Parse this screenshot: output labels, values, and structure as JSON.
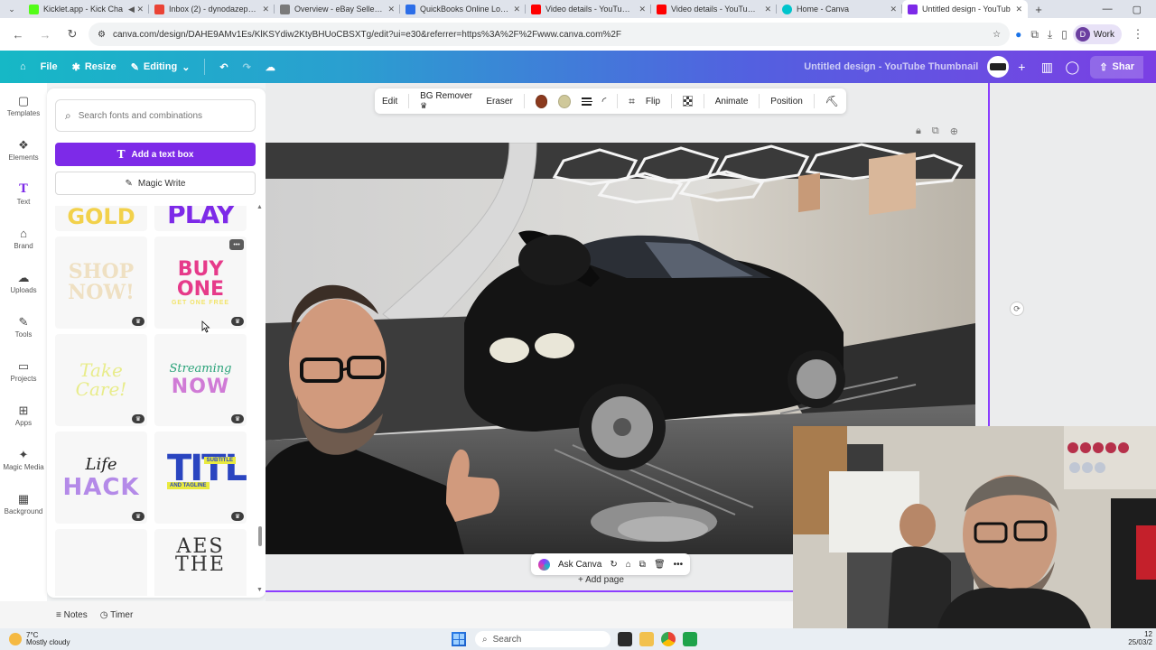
{
  "browser": {
    "tabs": [
      {
        "label": "Kicklet.app - Kick Cha",
        "color": "#53fc18",
        "active": false
      },
      {
        "label": "Inbox (2) - dynodazepp@",
        "color": "#ea4335",
        "active": false
      },
      {
        "label": "Overview - eBay Seller Hu",
        "color": "#7a7a7a",
        "active": false
      },
      {
        "label": "QuickBooks Online Login",
        "color": "#2ca01c",
        "active": false
      },
      {
        "label": "Video details - YouTube S",
        "color": "#ff0000",
        "active": false
      },
      {
        "label": "Video details - YouTube S",
        "color": "#ff0000",
        "active": false
      },
      {
        "label": "Home - Canva",
        "color": "#00c4cc",
        "active": false
      },
      {
        "label": "Untitled design - YouTub",
        "color": "#7d2ae8",
        "active": true
      }
    ],
    "url": "canva.com/design/DAHE9AMv1Es/KlKSYdiw2KtyBHUoCBSXTg/edit?ui=e30&referrer=https%3A%2F%2Fwww.canva.com%2F",
    "profile_initial": "D",
    "profile_label": "Work"
  },
  "header": {
    "file_label": "File",
    "resize_label": "Resize",
    "editing_label": "Editing",
    "design_title": "Untitled design - YouTube Thumbnail",
    "share_label": "Shar"
  },
  "rail": [
    {
      "label": "Templates",
      "icon": "templates-icon",
      "glyph": "▢"
    },
    {
      "label": "Elements",
      "icon": "elements-icon",
      "glyph": "❖"
    },
    {
      "label": "Text",
      "icon": "text-icon",
      "glyph": "T"
    },
    {
      "label": "Brand",
      "icon": "brand-icon",
      "glyph": "⌂"
    },
    {
      "label": "Uploads",
      "icon": "uploads-icon",
      "glyph": "☁"
    },
    {
      "label": "Tools",
      "icon": "tools-icon",
      "glyph": "✎"
    },
    {
      "label": "Projects",
      "icon": "projects-icon",
      "glyph": "▭"
    },
    {
      "label": "Apps",
      "icon": "apps-icon",
      "glyph": "⊞"
    },
    {
      "label": "Magic Media",
      "icon": "magic-media-icon",
      "glyph": "✦"
    },
    {
      "label": "Background",
      "icon": "background-icon",
      "glyph": "▦"
    }
  ],
  "panel": {
    "search_placeholder": "Search fonts and combinations",
    "add_text_label": "Add a text box",
    "magic_write_label": "Magic Write",
    "presets": {
      "gold": "GOLD",
      "play": "PLAY",
      "shop_1": "SHOP",
      "shop_2": "NOW!",
      "buy": "BUY ONE",
      "buy_sub": "GET ONE FREE",
      "take_1": "Take",
      "take_2": "Care!",
      "stream_1": "Streaming",
      "stream_2": "NOW",
      "life_1": "Life",
      "life_2": "HACK",
      "title": "TITLE",
      "title_sub": "SUBTITLE",
      "title_tag": "AND TAGLINE",
      "aes": "AES THE"
    }
  },
  "toolbar": {
    "edit": "Edit",
    "bg_remover": "BG Remover",
    "eraser": "Eraser",
    "color_1": "#8b3a1e",
    "color_2": "#cfc89a",
    "flip": "Flip",
    "animate": "Animate",
    "position": "Position"
  },
  "canvas": {
    "ask_canva": "Ask Canva",
    "add_page": "+ Add page"
  },
  "footer": {
    "notes": "Notes",
    "timer": "Timer"
  },
  "taskbar": {
    "temp": "7°C",
    "weather": "Mostly cloudy",
    "search": "Search",
    "time": "12",
    "date": "25/03/2"
  }
}
